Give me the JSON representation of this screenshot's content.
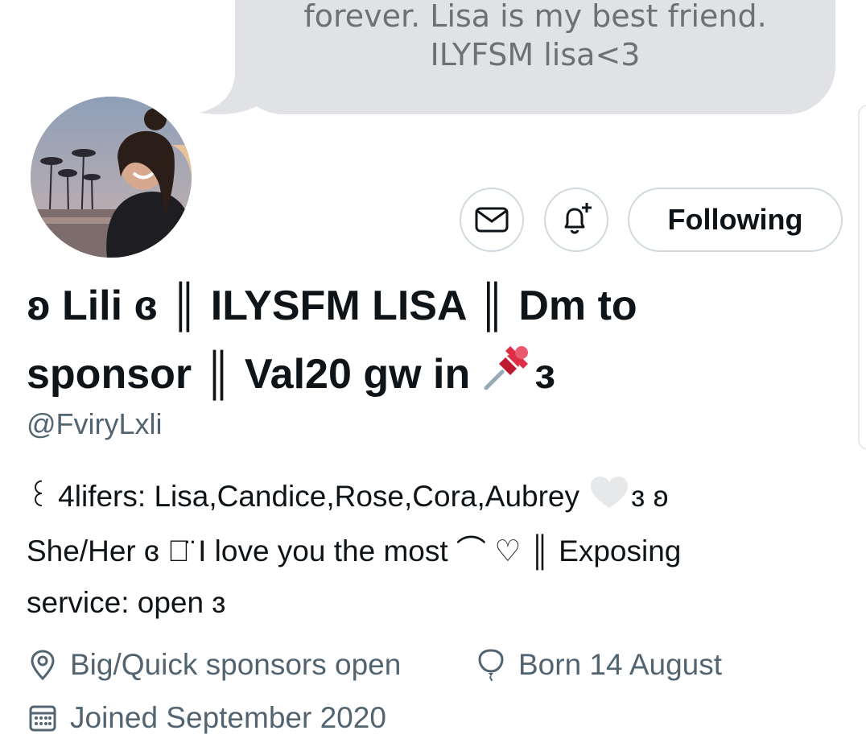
{
  "tweet_bubble": {
    "lines": [
      "forever. Lisa is my best friend.",
      "ILYFSM lisa<3"
    ]
  },
  "profile": {
    "name_line_1": "ʚ Lili ɞ ║ ILYSFM LISA ║ Dm to",
    "name_line_2": "sponsor ║ Val20 gw in",
    "name_suffix": "ɜ",
    "handle": "@FviryLxli"
  },
  "bio": {
    "line_1_a": "꒰ 4lifers: Lisa,Candice,Rose,Cora,Aubrey",
    "line_1_b": "ɜ ʚ",
    "line_2_a": "She/Her ɞ    ⌒̈ I love you the most ⌒ ♡",
    "line_2_b": " ║ Exposing",
    "line_3": "service: open ɜ"
  },
  "actions": {
    "following_label": "Following"
  },
  "meta": {
    "location": "Big/Quick sponsors open",
    "birthday": "Born 14 August",
    "joined": "Joined September 2020"
  },
  "icons": {
    "message": "envelope-icon",
    "notify": "bell-plus-icon",
    "location": "location-pin-icon",
    "birthday": "balloon-icon",
    "joined": "calendar-icon",
    "pin_emoji": "pushpin-icon",
    "heart_emoji": "white-heart-icon"
  },
  "colors": {
    "text_primary": "#0f1419",
    "text_secondary": "#536471",
    "border": "#cfd9de",
    "bubble": "#e1e2e6",
    "pin_red": "#dd2e44"
  }
}
